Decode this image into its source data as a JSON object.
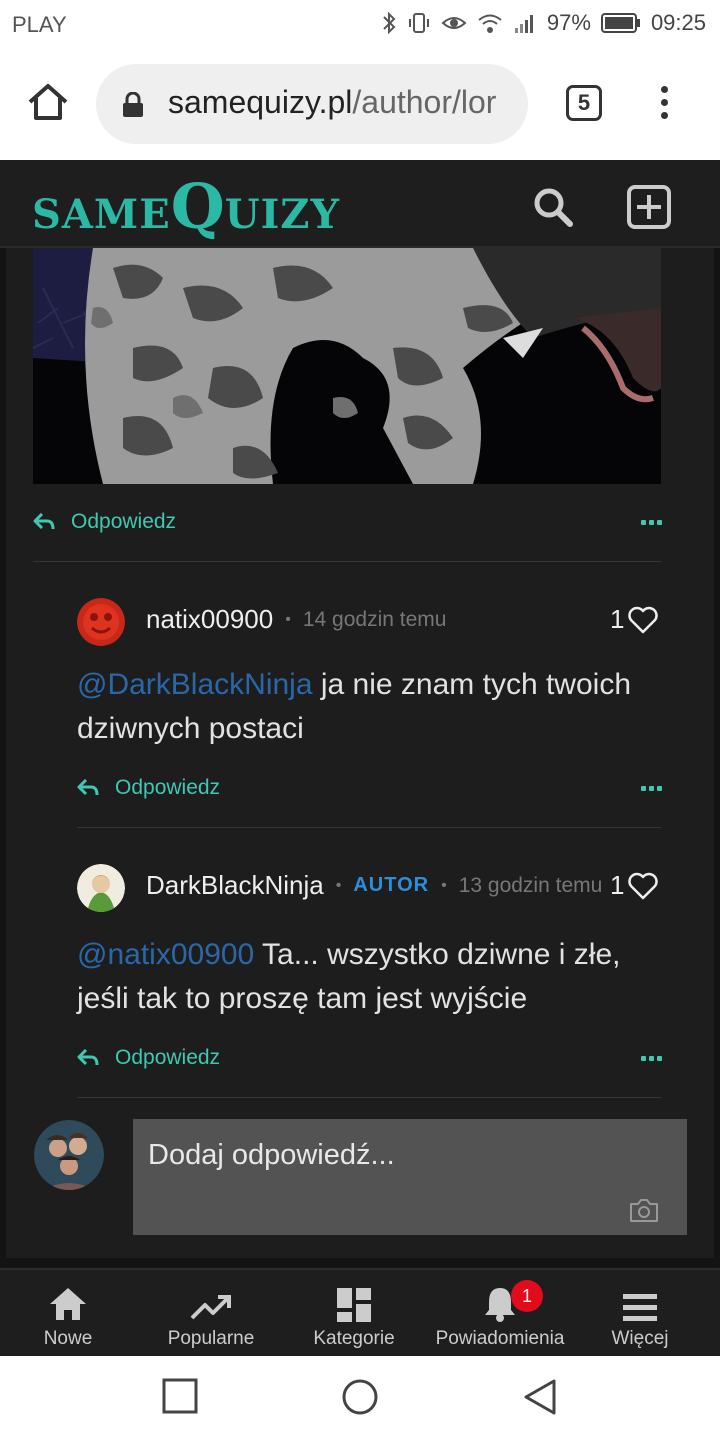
{
  "status_bar": {
    "carrier": "PLAY",
    "battery": "97%",
    "time": "09:25"
  },
  "browser": {
    "url_domain": "samequizy.pl",
    "url_path": "/author/lor",
    "tab_count": "5"
  },
  "site": {
    "logo_small": "SAME",
    "logo_big": "Q",
    "logo_rest": "UIZY",
    "accent_color": "#2bb8a4"
  },
  "comments": [
    {
      "reply_label": "Odpowiedz"
    },
    {
      "author": "natix00900",
      "time": "14 godzin temu",
      "likes": "1",
      "mention": "@DarkBlackNinja",
      "text": " ja nie znam tych twoich dziwnych postaci",
      "reply_label": "Odpowiedz"
    },
    {
      "author": "DarkBlackNinja",
      "badge": "AUTOR",
      "time": "13 godzin temu",
      "likes": "1",
      "mention": "@natix00900",
      "text": " Ta... wszystko dziwne i złe, jeśli tak to proszę tam jest wyjście",
      "reply_label": "Odpowiedz"
    }
  ],
  "reply_box": {
    "placeholder": "Dodaj odpowiedź..."
  },
  "bottom_nav": {
    "items": [
      {
        "label": "Nowe",
        "icon": "home-icon"
      },
      {
        "label": "Popularne",
        "icon": "trending-icon"
      },
      {
        "label": "Kategorie",
        "icon": "grid-icon"
      },
      {
        "label": "Powiadomienia",
        "icon": "bell-icon",
        "badge": "1"
      },
      {
        "label": "Więcej",
        "icon": "menu-icon"
      }
    ]
  }
}
